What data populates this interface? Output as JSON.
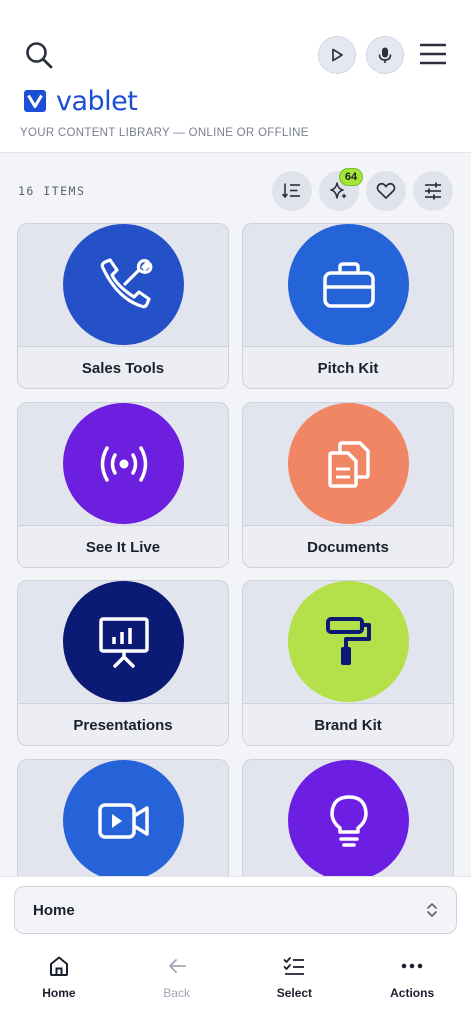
{
  "header": {
    "brand": "vablet",
    "tagline": "YOUR CONTENT LIBRARY — ONLINE OR OFFLINE",
    "icons": [
      "search-icon",
      "play-icon",
      "microphone-icon",
      "hamburger-menu-icon"
    ]
  },
  "toolbar": {
    "items_count": "16 ITEMS",
    "new_badge": "64",
    "icons": [
      "sort-list-icon",
      "sparkle-icon",
      "heart-icon",
      "sliders-icon"
    ]
  },
  "cards": [
    {
      "label": "Sales Tools",
      "color": "#2450c8",
      "icon": "phone-wrench-icon"
    },
    {
      "label": "Pitch Kit",
      "color": "#2563d9",
      "icon": "briefcase-icon"
    },
    {
      "label": "See It Live",
      "color": "#6d1fe0",
      "icon": "broadcast-icon"
    },
    {
      "label": "Documents",
      "color": "#f08664",
      "icon": "documents-icon"
    },
    {
      "label": "Presentations",
      "color": "#0b1a75",
      "icon": "presentation-board-icon"
    },
    {
      "label": "Brand Kit",
      "color": "#b4e04a",
      "icon": "paint-roller-icon"
    },
    {
      "label": "",
      "color": "#2663d8",
      "icon": "video-camera-icon"
    },
    {
      "label": "",
      "color": "#6c1fe3",
      "icon": "lightbulb-icon"
    }
  ],
  "location_select": {
    "value": "Home"
  },
  "bottom_nav": [
    {
      "label": "Home",
      "icon": "home-icon",
      "enabled": true
    },
    {
      "label": "Back",
      "icon": "arrow-left-icon",
      "enabled": false
    },
    {
      "label": "Select",
      "icon": "checklist-icon",
      "enabled": true
    },
    {
      "label": "Actions",
      "icon": "more-dots-icon",
      "enabled": true
    }
  ]
}
